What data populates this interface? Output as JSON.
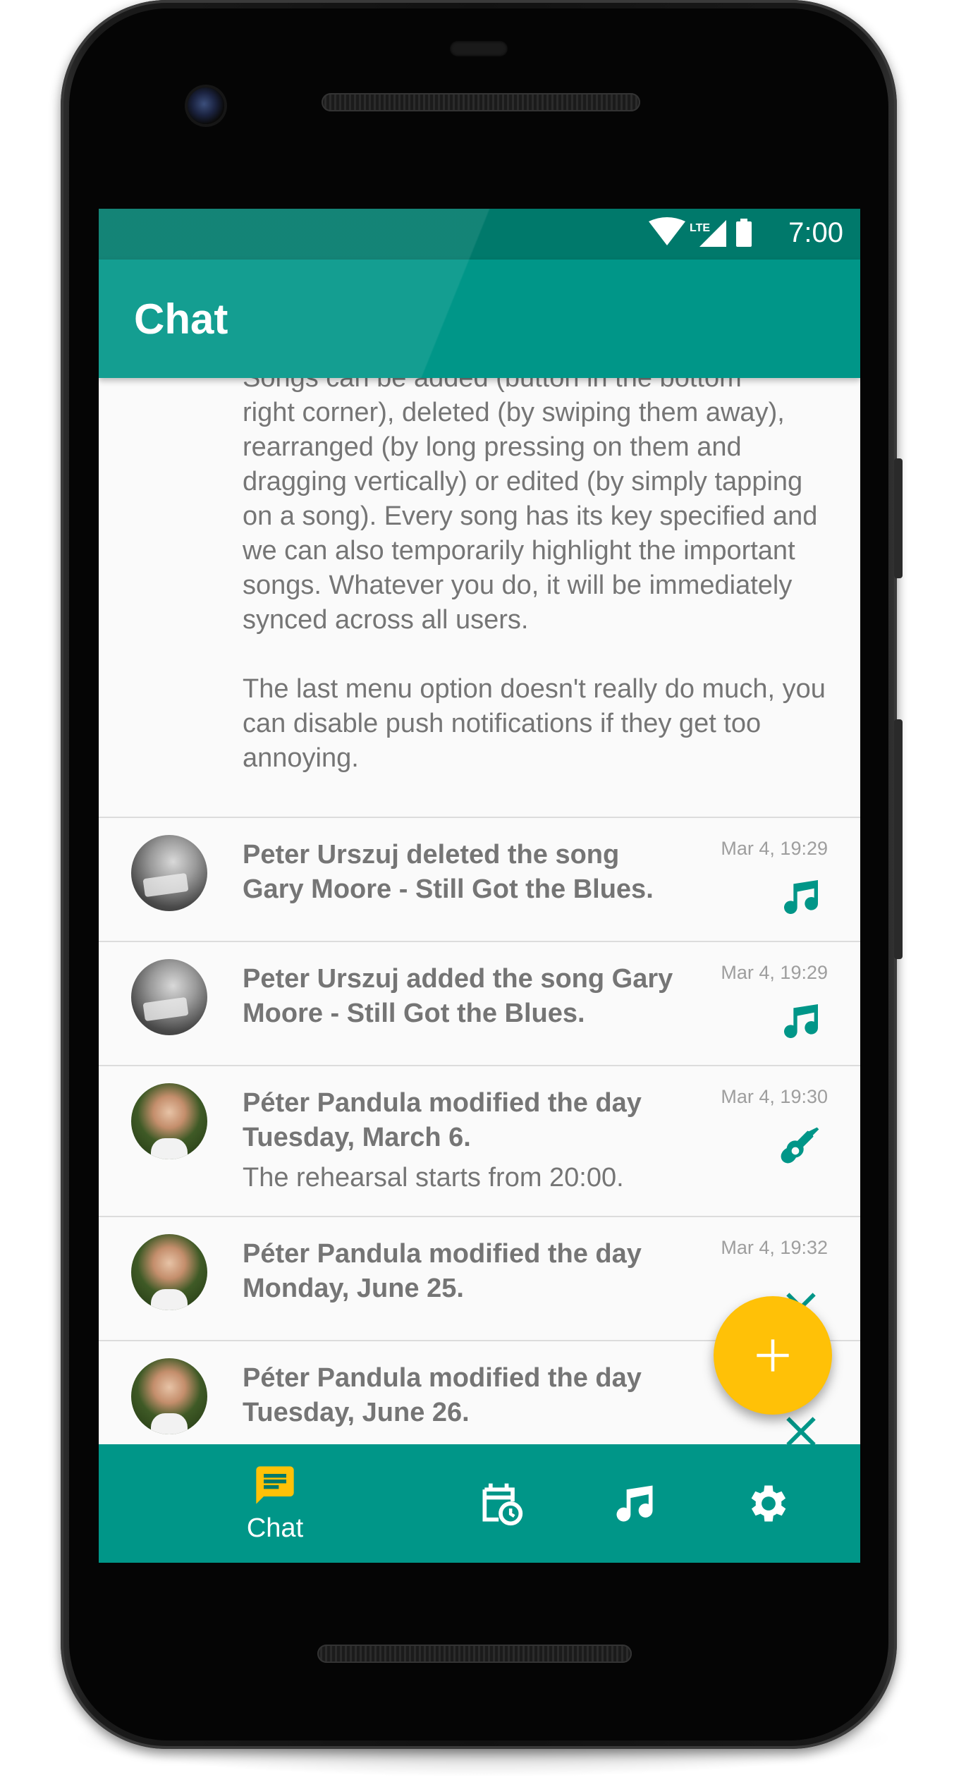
{
  "status_bar": {
    "time": "7:00",
    "network": "LTE"
  },
  "app_bar": {
    "title": "Chat"
  },
  "intro": {
    "partial_line": "Songs can be added (button in the bottom",
    "paragraph1": "right corner), deleted (by swiping them away), rearranged (by long pressing on them and dragging vertically) or edited (by simply tapping on a song). Every song has its key specified and we can also temporarily highlight the important songs. Whatever you do, it will be immediately synced across all users.",
    "paragraph2": "The last menu option doesn't really do much, you can disable push notifications if they get too annoying."
  },
  "messages": [
    {
      "author": "Peter Urszuj",
      "text_line1": "Peter Urszuj deleted the song",
      "text_line2": "Gary Moore - Still Got the Blues.",
      "time": "Mar 4, 19:29",
      "icon": "music-note-icon"
    },
    {
      "author": "Peter Urszuj",
      "text_line1": "Peter Urszuj added the song Gary",
      "text_line2": "Moore - Still Got the Blues.",
      "time": "Mar 4, 19:29",
      "icon": "music-note-icon"
    },
    {
      "author": "Péter Pandula",
      "text_line1": "Péter Pandula modified the day",
      "text_line2": "Tuesday, March 6.",
      "extra": "The rehearsal starts from 20:00.",
      "time": "Mar 4, 19:30",
      "icon": "guitar-icon"
    },
    {
      "author": "Péter Pandula",
      "text_line1": "Péter Pandula modified the day",
      "text_line2": "Monday, June 25.",
      "time": "Mar 4, 19:32",
      "icon": "close-icon"
    },
    {
      "author": "Péter Pandula",
      "text_line1": "Péter Pandula modified the day",
      "text_line2": "Tuesday, June 26.",
      "time": "",
      "icon": "close-icon"
    }
  ],
  "fab": {
    "icon": "plus-icon"
  },
  "bottom_nav": {
    "items": [
      {
        "label": "Chat",
        "icon": "chat-icon",
        "active": true
      },
      {
        "label": "",
        "icon": "calendar-clock-icon"
      },
      {
        "label": "",
        "icon": "music-note-icon"
      },
      {
        "label": "",
        "icon": "gear-icon"
      }
    ]
  },
  "colors": {
    "primary": "#009688",
    "primary_dark": "#00796b",
    "accent": "#ffc107",
    "text_secondary": "#757575"
  }
}
